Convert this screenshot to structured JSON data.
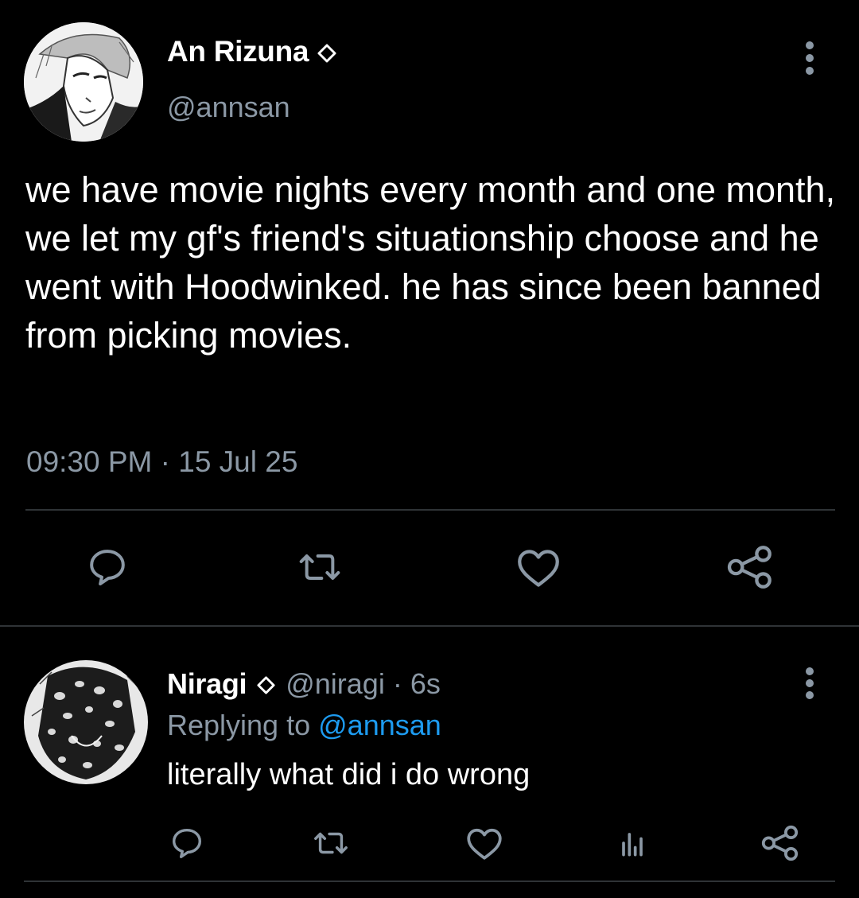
{
  "main_tweet": {
    "author": {
      "display_name": "An Rizuna",
      "handle": "@annsan",
      "badge_icon": "diamond-icon"
    },
    "text": "we have movie nights every month and one month, we let my gf's friend's situationship choose and he went with Hoodwinked. he has since been banned from picking movies.",
    "timestamp": "09:30 PM · 15 Jul 25",
    "actions": [
      "reply-icon",
      "retweet-icon",
      "like-icon",
      "share-icon"
    ]
  },
  "reply": {
    "author": {
      "display_name": "Niragi",
      "handle": "@niragi",
      "badge_icon": "diamond-icon"
    },
    "time_ago": "6s",
    "separator": "·",
    "replying_prefix": "Replying to",
    "replying_to": "@annsan",
    "text": "literally what did i do wrong",
    "actions": [
      "reply-icon",
      "retweet-icon",
      "like-icon",
      "analytics-icon",
      "share-icon"
    ]
  },
  "colors": {
    "background": "#000000",
    "text_primary": "#ffffff",
    "text_secondary": "#8b98a5",
    "link": "#1d9bf0",
    "divider": "#2f3336"
  }
}
